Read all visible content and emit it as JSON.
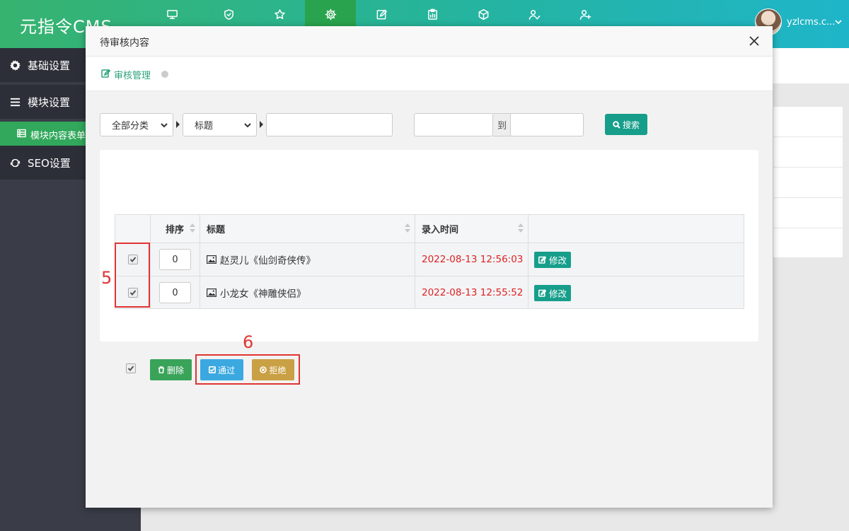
{
  "app": {
    "logo": "元指令CMS",
    "user": {
      "name": "yzlcms.c..."
    },
    "nav_icons": [
      "monitor-icon",
      "shield-icon",
      "star-icon",
      "gear-icon",
      "edit-icon",
      "clipboard-icon",
      "cube-icon",
      "user-check-icon",
      "user-plus-icon"
    ],
    "active_nav": "gear-icon"
  },
  "sidebar": {
    "items": [
      {
        "label": "基础设置",
        "icon": "gear-icon"
      },
      {
        "label": "模块设置",
        "icon": "menu-icon"
      },
      {
        "label": "SEO设置",
        "icon": "refresh-icon"
      }
    ],
    "sub_item": {
      "label": "模块内容表单",
      "icon": "list-icon"
    }
  },
  "modal": {
    "title": "待审核内容",
    "breadcrumb": "审核管理",
    "filters": {
      "category": "全部分类",
      "field": "标题",
      "keyword": "",
      "date_from": "",
      "date_to": "",
      "date_sep": "到",
      "search_label": "搜索"
    },
    "table": {
      "headers": {
        "sort": "排序",
        "title": "标题",
        "time": "录入时间"
      },
      "rows": [
        {
          "checked": true,
          "sort": "0",
          "title": "赵灵儿《仙剑奇侠传》",
          "time": "2022-08-13 12:56:03",
          "action": "修改"
        },
        {
          "checked": true,
          "sort": "0",
          "title": "小龙女《神雕侠侣》",
          "time": "2022-08-13 12:55:52",
          "action": "修改"
        }
      ]
    },
    "actions": {
      "delete": "删除",
      "approve": "通过",
      "reject": "拒绝"
    },
    "colors": {
      "accent": "#169e8a",
      "delete": "#3aa35a",
      "approve": "#3ba9e0",
      "reject": "#c9a043",
      "time": "#e02222"
    }
  },
  "annotations": {
    "rows_marker": "5",
    "buttons_marker": "6"
  }
}
